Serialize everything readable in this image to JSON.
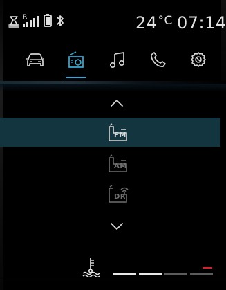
{
  "status_bar": {
    "temperature": "24",
    "temperature_unit": "°C",
    "clock": "07:14",
    "signal_indicator": "R",
    "icons": [
      "message-icon",
      "signal-strength-icon",
      "phone-battery-icon",
      "bluetooth-icon"
    ]
  },
  "tabs": [
    {
      "name": "vehicle",
      "icon": "car-icon",
      "selected": false
    },
    {
      "name": "radio",
      "icon": "radio-icon",
      "selected": true
    },
    {
      "name": "music",
      "icon": "music-note-icon",
      "selected": false
    },
    {
      "name": "phone",
      "icon": "phone-icon",
      "selected": false
    },
    {
      "name": "settings",
      "icon": "settings-gear-icon",
      "selected": false
    }
  ],
  "sources": [
    {
      "label": "FM",
      "selected": true,
      "icon": "fm-radio-icon"
    },
    {
      "label": "AM",
      "selected": false,
      "icon": "am-radio-icon"
    },
    {
      "label": "DR",
      "selected": false,
      "icon": "digital-radio-icon"
    }
  ],
  "navigation": {
    "scroll_up_icon": "chevron-up-icon",
    "scroll_down_icon": "chevron-down-icon"
  },
  "coolant_gauge": {
    "icon": "coolant-temperature-icon",
    "level": 0.5,
    "segments": 4,
    "active_segments": 2,
    "colors": {
      "active": "#e7e7e7",
      "inactive": "#5c5c5c",
      "warning": "#d3222a"
    }
  },
  "colors": {
    "accent": "#38a9d6",
    "selected_row": "#12353f",
    "text": "#d9d9d9",
    "background": "#000000"
  }
}
